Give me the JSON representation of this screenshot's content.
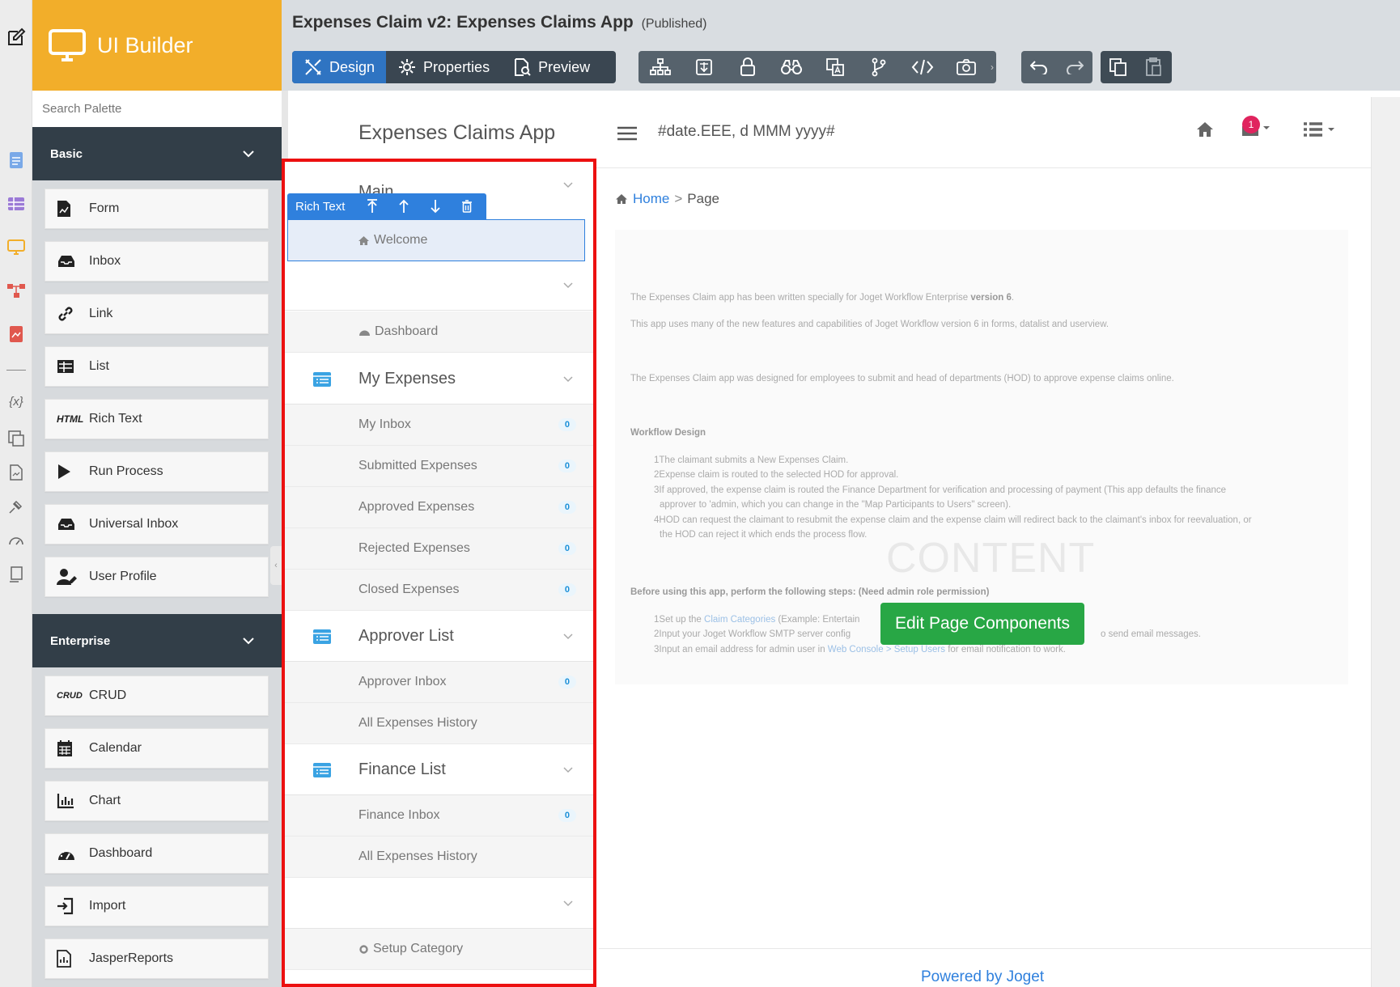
{
  "palette": {
    "brand": "UI Builder",
    "search_placeholder": "Search Palette",
    "basic": {
      "label": "Basic",
      "items": [
        {
          "label": "Form",
          "icon": "form-icon"
        },
        {
          "label": "Inbox",
          "icon": "inbox-icon"
        },
        {
          "label": "Link",
          "icon": "link-icon"
        },
        {
          "label": "List",
          "icon": "list-icon"
        },
        {
          "label": "Rich Text",
          "icon": "html-icon",
          "icon_text": "HTML"
        },
        {
          "label": "Run Process",
          "icon": "play-icon"
        },
        {
          "label": "Universal Inbox",
          "icon": "inbox-icon"
        },
        {
          "label": "User Profile",
          "icon": "user-icon"
        }
      ]
    },
    "enterprise": {
      "label": "Enterprise",
      "items": [
        {
          "label": "CRUD",
          "icon": "crud-icon",
          "icon_text": "CRUD"
        },
        {
          "label": "Calendar",
          "icon": "calendar-icon"
        },
        {
          "label": "Chart",
          "icon": "chart-icon"
        },
        {
          "label": "Dashboard",
          "icon": "dashboard-icon"
        },
        {
          "label": "Import",
          "icon": "import-icon"
        },
        {
          "label": "JasperReports",
          "icon": "report-icon"
        }
      ]
    }
  },
  "topbar": {
    "title": "Expenses Claim v2: Expenses Claims App",
    "status": "(Published)",
    "modes": {
      "design": "Design",
      "properties": "Properties",
      "preview": "Preview"
    }
  },
  "app": {
    "name": "Expenses Claims App",
    "date_format": "#date.EEE, d MMM yyyy#",
    "notification_count": "1",
    "menu": {
      "main_label": "Main",
      "welcome": "Welcome",
      "dashboard": "Dashboard",
      "my_expenses": "My Expenses",
      "my_expenses_items": [
        {
          "label": "My Inbox",
          "count": "0"
        },
        {
          "label": "Submitted Expenses",
          "count": "0"
        },
        {
          "label": "Approved Expenses",
          "count": "0"
        },
        {
          "label": "Rejected Expenses",
          "count": "0"
        },
        {
          "label": "Closed Expenses",
          "count": "0"
        }
      ],
      "approver_list": "Approver List",
      "approver_items": [
        {
          "label": "Approver Inbox",
          "count": "0"
        },
        {
          "label": "All Expenses History",
          "count": ""
        }
      ],
      "finance_list": "Finance List",
      "finance_items": [
        {
          "label": "Finance Inbox",
          "count": "0"
        },
        {
          "label": "All Expenses History",
          "count": ""
        }
      ],
      "setup_category": "Setup Category"
    },
    "selected_toolbar": {
      "label": "Rich Text"
    },
    "breadcrumb": {
      "home": "Home",
      "separator": ">",
      "page": "Page"
    },
    "content": {
      "p1_pre": "The Expenses Claim app has been written specially for Joget Workflow Enterprise ",
      "p1_bold": "version 6",
      "p1_post": ".",
      "p2": "This app uses many of the new features and capabilities of Joget Workflow version 6 in forms, datalist and userview.",
      "p3": "The Expenses Claim app was designed for employees to submit and head of departments (HOD) to approve expense claims online.",
      "workflow_heading": "Workflow Design",
      "steps": [
        "1The claimant submits a New Expenses Claim.",
        "2Expense claim is routed to the selected HOD for approval.",
        "3If approved, the expense claim is routed the Finance Department for verification and processing of payment (This app defaults the finance",
        "approver to 'admin, which you can change in the \"Map Participants to Users\" screen).",
        "4HOD can request the claimant to resubmit the expense claim and the expense claim will redirect back to the claimant's inbox for reevaluation, or",
        "the HOD can reject it which ends the process flow."
      ],
      "before_heading": "Before using this app, perform the following steps: (Need admin role permission)",
      "setup1_pre": "1Set up the ",
      "setup1_link": "Claim Categories",
      "setup1_post": " (Example: Entertain",
      "setup2_pre": "2Input your Joget Workflow SMTP server config",
      "setup2_post": "o send email messages.",
      "setup3_pre": "3Input an email address for admin user in ",
      "setup3_link": "Web Console > Setup Users",
      "setup3_post": " for email notification to work.",
      "watermark": "CONTENT",
      "edit_button": "Edit Page Components"
    },
    "footer": "Powered by Joget"
  },
  "colors": {
    "brand": "#f2ae2a",
    "dark": "#323e48",
    "accent": "#2f80dd",
    "selection_outline": "#ec1010",
    "edit_button": "#28a745"
  }
}
